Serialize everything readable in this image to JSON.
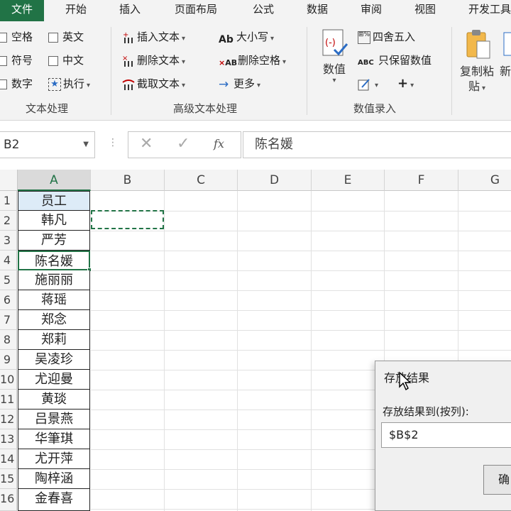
{
  "tabs": [
    "文件",
    "开始",
    "插入",
    "页面布局",
    "公式",
    "数据",
    "审阅",
    "视图",
    "开发工具"
  ],
  "ribbon": {
    "text_group": {
      "items": [
        "空格",
        "符号",
        "数字",
        "英文",
        "中文",
        "执行"
      ],
      "label": "文本处理"
    },
    "advanced_group": {
      "items": [
        "插入文本",
        "删除文本",
        "截取文本",
        "大小写",
        "删除空格",
        "更多"
      ],
      "label": "高级文本处理"
    },
    "numeric_group": {
      "big_button": "数值",
      "items": [
        "四舍五入",
        "只保留数值"
      ],
      "label": "数值录入"
    },
    "paste_group": {
      "copy_paste_line1": "复制粘",
      "copy_paste_line2": "贴",
      "new_partial": "新"
    }
  },
  "formula_bar": {
    "name_box": "B2",
    "fx": "fx",
    "formula": "陈名媛"
  },
  "grid": {
    "columns": [
      "A",
      "B",
      "C",
      "D",
      "E",
      "F",
      "G"
    ],
    "row_numbers": [
      "1",
      "2",
      "3",
      "4",
      "5",
      "6",
      "7",
      "8",
      "9",
      "10",
      "11",
      "12",
      "13",
      "14",
      "15",
      "16"
    ],
    "column_a": [
      "员工",
      "韩凡",
      "严芳",
      "陈名媛",
      "施丽丽",
      "蒋瑶",
      "郑念",
      "郑莉",
      "吴凌珍",
      "尤迎曼",
      "黄琰",
      "吕景燕",
      "华筆琪",
      "尤开萍",
      "陶梓涵",
      "金春喜"
    ]
  },
  "dialog": {
    "title": "存放结果",
    "label": "存放结果到(按列):",
    "value": "$B$2",
    "ok_partial": "确"
  }
}
